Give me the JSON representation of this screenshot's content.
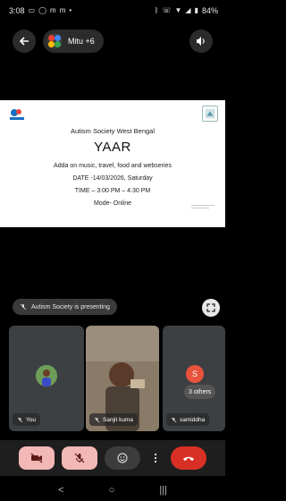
{
  "status_bar": {
    "time": "3:08",
    "left_icons": [
      "screen-record-icon",
      "whatsapp-icon",
      "gmail-icon",
      "gmail-icon",
      "dot-icon"
    ],
    "right_icons": [
      "bluetooth-icon",
      "volte-icon",
      "wifi-icon",
      "signal-icon"
    ],
    "battery": "84%"
  },
  "header": {
    "chip_label": "Mitu +6"
  },
  "slide": {
    "org": "Autism Society West Bengal",
    "title": "YAAR",
    "subtitle": "Adda on music, travel, food and webseries",
    "date": "DATE -14/03/2026, Saturday",
    "time": "TIME – 3:00 PM – 4:30 PM",
    "mode": "Mode- Online"
  },
  "presenting": {
    "label": "Autism Society is presenting"
  },
  "tiles": {
    "you": {
      "label": "You"
    },
    "sanjit": {
      "label": "Sanjit kuma"
    },
    "others": {
      "initial": "S",
      "count": "3 others",
      "label": "samiddha"
    }
  },
  "colors": {
    "background": "#000000",
    "tile": "#3c4043",
    "muted_control": "#f2b8b5",
    "end_call": "#d93025",
    "avatar_others": "#e8533c"
  }
}
